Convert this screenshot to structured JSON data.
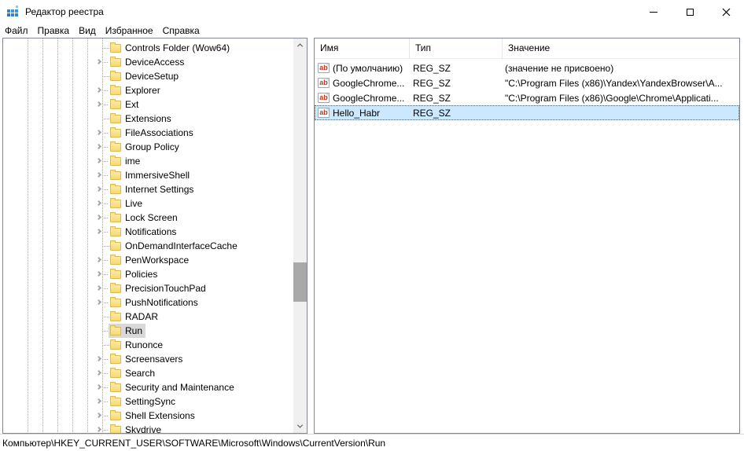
{
  "window": {
    "title": "Редактор реестра"
  },
  "menu": {
    "items": [
      "Файл",
      "Правка",
      "Вид",
      "Избранное",
      "Справка"
    ]
  },
  "tree": {
    "items": [
      {
        "label": "Controls Folder (Wow64)",
        "expandable": false,
        "selected": false
      },
      {
        "label": "DeviceAccess",
        "expandable": true,
        "selected": false
      },
      {
        "label": "DeviceSetup",
        "expandable": false,
        "selected": false
      },
      {
        "label": "Explorer",
        "expandable": true,
        "selected": false
      },
      {
        "label": "Ext",
        "expandable": true,
        "selected": false
      },
      {
        "label": "Extensions",
        "expandable": false,
        "selected": false
      },
      {
        "label": "FileAssociations",
        "expandable": true,
        "selected": false
      },
      {
        "label": "Group Policy",
        "expandable": true,
        "selected": false
      },
      {
        "label": "ime",
        "expandable": true,
        "selected": false
      },
      {
        "label": "ImmersiveShell",
        "expandable": true,
        "selected": false
      },
      {
        "label": "Internet Settings",
        "expandable": true,
        "selected": false
      },
      {
        "label": "Live",
        "expandable": true,
        "selected": false
      },
      {
        "label": "Lock Screen",
        "expandable": true,
        "selected": false
      },
      {
        "label": "Notifications",
        "expandable": true,
        "selected": false
      },
      {
        "label": "OnDemandInterfaceCache",
        "expandable": false,
        "selected": false
      },
      {
        "label": "PenWorkspace",
        "expandable": true,
        "selected": false
      },
      {
        "label": "Policies",
        "expandable": true,
        "selected": false
      },
      {
        "label": "PrecisionTouchPad",
        "expandable": true,
        "selected": false
      },
      {
        "label": "PushNotifications",
        "expandable": true,
        "selected": false
      },
      {
        "label": "RADAR",
        "expandable": false,
        "selected": false
      },
      {
        "label": "Run",
        "expandable": false,
        "selected": true
      },
      {
        "label": "Runonce",
        "expandable": false,
        "selected": false
      },
      {
        "label": "Screensavers",
        "expandable": true,
        "selected": false
      },
      {
        "label": "Search",
        "expandable": true,
        "selected": false
      },
      {
        "label": "Security and Maintenance",
        "expandable": true,
        "selected": false
      },
      {
        "label": "SettingSync",
        "expandable": true,
        "selected": false
      },
      {
        "label": "Shell Extensions",
        "expandable": true,
        "selected": false
      },
      {
        "label": "Skydrive",
        "expandable": true,
        "selected": false
      }
    ]
  },
  "list": {
    "columns": [
      "Имя",
      "Тип",
      "Значение"
    ],
    "value_icon_glyph": "ab",
    "rows": [
      {
        "name": "(По умолчанию)",
        "type": "REG_SZ",
        "value": "(значение не присвоено)",
        "selected": false
      },
      {
        "name": "GoogleChrome...",
        "type": "REG_SZ",
        "value": "\"C:\\Program Files (x86)\\Yandex\\YandexBrowser\\A...",
        "selected": false
      },
      {
        "name": "GoogleChrome...",
        "type": "REG_SZ",
        "value": "\"C:\\Program Files (x86)\\Google\\Chrome\\Applicati...",
        "selected": false
      },
      {
        "name": "Hello_Habr",
        "type": "REG_SZ",
        "value": "",
        "selected": true
      }
    ]
  },
  "statusbar": {
    "path": "Компьютер\\HKEY_CURRENT_USER\\SOFTWARE\\Microsoft\\Windows\\CurrentVersion\\Run"
  },
  "icons": {
    "app": "registry-grid-icon",
    "minimize": "minimize-icon",
    "maximize": "maximize-icon",
    "close": "close-icon",
    "tree_expander": "chevron-right-icon",
    "tree_folder": "folder-icon",
    "value_type": "string-ab-icon"
  },
  "colors": {
    "selection_active": "#cce8ff",
    "selection_inactive": "#d9d9d9",
    "folder_yellow": "#f6d96f",
    "value_icon_red": "#c4351c",
    "panel_border": "#828790"
  }
}
